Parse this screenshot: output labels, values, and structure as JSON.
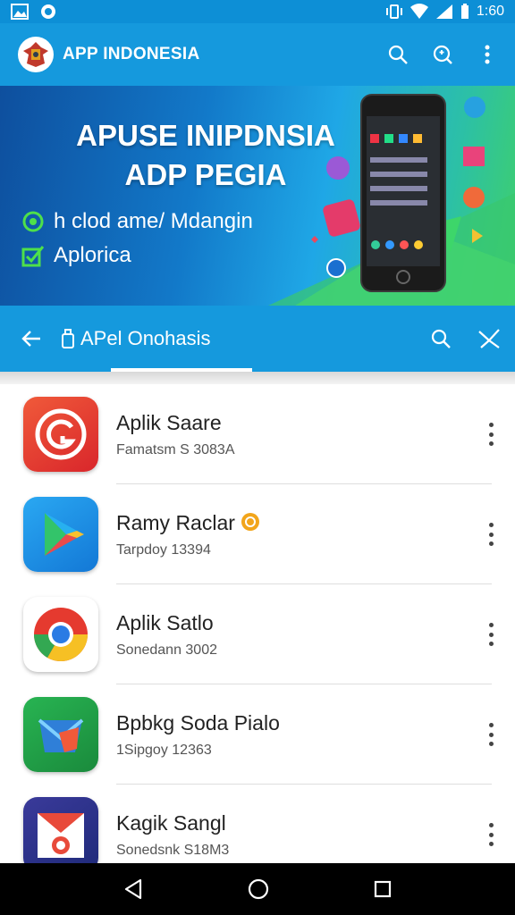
{
  "status_bar": {
    "time": "1:60"
  },
  "app_bar": {
    "title": "APP INDONESIA"
  },
  "banner": {
    "headline_line1": "APUSE INIPDNSIA",
    "headline_line2": "ADP PEGIA",
    "feature1": "h clod ame/ Mdangin",
    "feature2": "Aplorica"
  },
  "subbar": {
    "title": "APel Onohasis"
  },
  "apps": [
    {
      "name": "Aplik Saare",
      "sub": "Famatsm S 3083A"
    },
    {
      "name": "Ramy Raclar",
      "sub": "Tarpdoy 13394"
    },
    {
      "name": "Aplik Satlo",
      "sub": "Sonedann 3002"
    },
    {
      "name": "Bpbkg Soda Pialo",
      "sub": "1Sipgoy 12363"
    },
    {
      "name": "Kagik Sangl",
      "sub": "Sonedsnk S18M3"
    }
  ],
  "colors": {
    "primary": "#1599dd",
    "status": "#0d8fd6",
    "nav": "#000000"
  }
}
